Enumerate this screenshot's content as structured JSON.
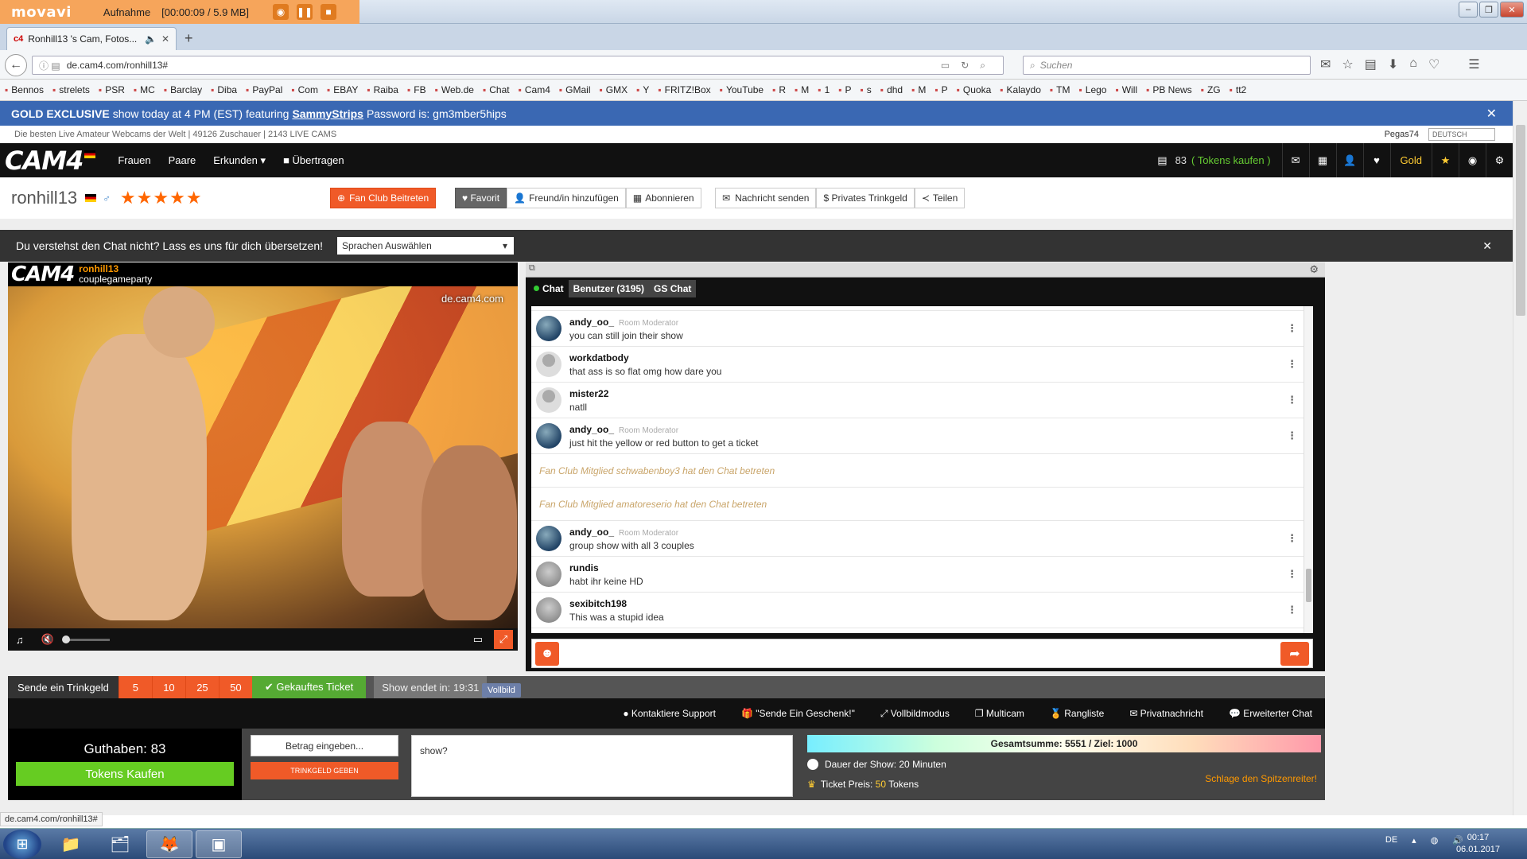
{
  "recorder": {
    "logo": "movavi",
    "label": "Aufnahme",
    "time": "[00:00:09 / 5.9 MB]"
  },
  "browser": {
    "tab_title": "Ronhill13 's Cam, Fotos...",
    "url": "de.cam4.com/ronhill13#",
    "search_placeholder": "Suchen",
    "bookmarks": [
      "Bennos",
      "strelets",
      "PSR",
      "MC",
      "Barclay",
      "Diba",
      "PayPal",
      "Com",
      "EBAY",
      "Raiba",
      "FB",
      "Web.de",
      "Chat",
      "Cam4",
      "GMail",
      "GMX",
      "Y",
      "FRITZ!Box",
      "YouTube",
      "R",
      "M",
      "1",
      "P",
      "s",
      "dhd",
      "M",
      "P",
      "Quoka",
      "Kalaydo",
      "TM",
      "Lego",
      "Will",
      "PB News",
      "ZG",
      "tt2"
    ]
  },
  "banner": {
    "prefix": "GOLD EXCLUSIVE",
    "text1": " show today at 4 PM (EST) featuring ",
    "link": "SammyStrips",
    "text2": " Password is: gm3mber5hips"
  },
  "subheader": {
    "text": "Die besten Live Amateur Webcams der Welt | 49126  Zuschauer | 2143  LIVE CAMS",
    "user": "Pegas74",
    "lang": "DEUTSCH"
  },
  "nav": {
    "logo": "CAM4",
    "links": [
      "Frauen",
      "Paare",
      "Erkunden ▾",
      "■ Übertragen"
    ],
    "tokens": "83",
    "buy": "( Tokens kaufen )",
    "gold": "Gold"
  },
  "profile": {
    "name": "ronhill13",
    "stars": "★★★★★",
    "fanclub": "Fan Club Beitreten",
    "buttons": [
      "♥ Favorit",
      "Freund/in hinzufügen",
      "Abonnieren"
    ],
    "buttons2": [
      "Nachricht senden",
      "$ Privates Trinkgeld",
      "Teilen"
    ]
  },
  "translate": {
    "text": "Du verstehst den Chat nicht? Lass es uns für dich übersetzen!",
    "select": "Sprachen Auswählen"
  },
  "video": {
    "logo": "CAM4",
    "user": "ronhill13",
    "show": "couplegameparty",
    "watermark": "de.cam4.com"
  },
  "chat": {
    "tabs": [
      "Chat",
      "Benutzer (3195)",
      "GS Chat"
    ],
    "messages": [
      {
        "kind": "msg",
        "user": "andy_oo_",
        "role": "Room Moderator",
        "text": "you can still join their show",
        "av": "blue"
      },
      {
        "kind": "msg",
        "user": "workdatbody",
        "role": "",
        "text": "that ass is so flat omg how dare you",
        "av": "grey"
      },
      {
        "kind": "msg",
        "user": "mister22",
        "role": "",
        "text": "natll",
        "av": "grey"
      },
      {
        "kind": "msg",
        "user": "andy_oo_",
        "role": "Room Moderator",
        "text": "just hit the yellow or red button to get a ticket",
        "av": "blue"
      },
      {
        "kind": "sys",
        "text": "Fan Club Mitglied schwabenboy3 hat den Chat betreten"
      },
      {
        "kind": "sys",
        "text": "Fan Club Mitglied amatoreserio hat den Chat betreten"
      },
      {
        "kind": "msg",
        "user": "andy_oo_",
        "role": "Room Moderator",
        "text": "group show with all 3 couples",
        "av": "blue"
      },
      {
        "kind": "msg",
        "user": "rundis",
        "role": "",
        "text": "habt ihr keine HD",
        "av": "bg"
      },
      {
        "kind": "msg",
        "user": "sexibitch198",
        "role": "",
        "text": "This was a stupid idea",
        "av": "bg"
      }
    ]
  },
  "tipbar": {
    "label": "Sende ein Trinkgeld",
    "amounts": [
      "5",
      "10",
      "25",
      "50"
    ],
    "ticket": "✔ Gekauftes Ticket",
    "ends": "Show endet in: 19:31",
    "tooltip": "Vollbild"
  },
  "actions": [
    "● Kontaktiere Support",
    "🎁 \"Sende Ein Geschenk!\"",
    "⤢ Vollbildmodus",
    "❐ Multicam",
    "🏅 Rangliste",
    "✉ Privatnachricht",
    "💬 Erweiterter Chat"
  ],
  "bottom": {
    "balance": "Guthaben: 83",
    "buy": "Tokens Kaufen",
    "amount": "Betrag eingeben...",
    "give": "TRINKGELD GEBEN",
    "message": "show?",
    "goal": "Gesamtsumme: 5551 / Ziel: 1000",
    "duration": "Dauer der Show: 20 Minuten",
    "price_label": "Ticket Preis: ",
    "price_value": "50",
    "price_unit": " Tokens",
    "beat": "Schlage den Spitzenreiter!"
  },
  "status_link": "de.cam4.com/ronhill13#",
  "taskbar": {
    "lang": "DE",
    "time": "00:17",
    "date": "06.01.2017"
  }
}
